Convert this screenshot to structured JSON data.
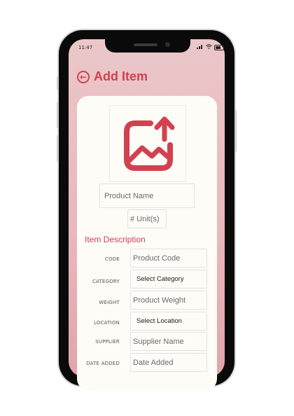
{
  "status_bar": {
    "time": "11:47",
    "battery": "80"
  },
  "header": {
    "title": "Add Item"
  },
  "image_upload": {
    "icon": "image-upload-icon",
    "accent": "#d1414f"
  },
  "product_name": {
    "placeholder": "Product Name"
  },
  "units": {
    "placeholder": "# Unit(s)"
  },
  "item_description": {
    "title": "Item Description",
    "rows": [
      {
        "label": "CODE",
        "value": "Product Code"
      },
      {
        "label": "CATEGORY",
        "value": "Select Category"
      },
      {
        "label": "WEIGHT",
        "value": "Product Weight"
      },
      {
        "label": "LOCATION",
        "value": "Select Location"
      },
      {
        "label": "SUPPLIER",
        "value": "Supplier Name"
      },
      {
        "label": "DATE ADDED",
        "value": "Date Added"
      }
    ]
  },
  "colors": {
    "accent": "#d1414f",
    "background": "#e8b7bb",
    "card": "#fdfcf7"
  }
}
